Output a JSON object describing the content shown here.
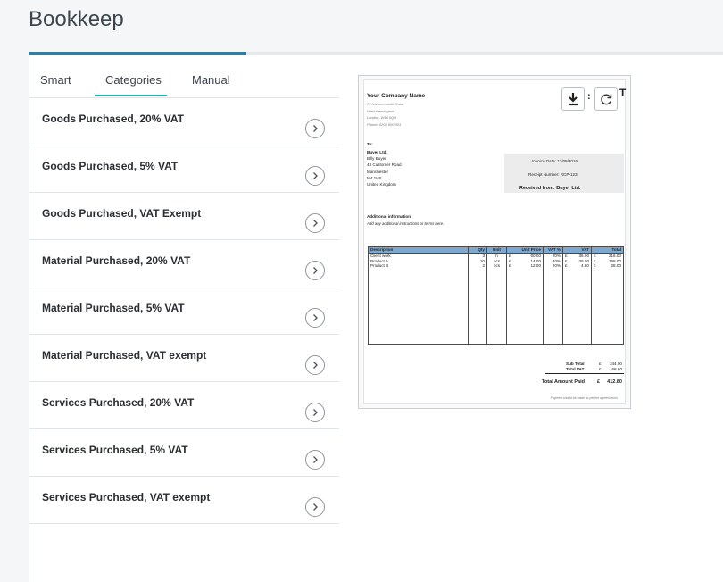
{
  "app": {
    "title": "Bookkeep"
  },
  "progress": {
    "percent": 31.4
  },
  "tabs": [
    {
      "label": "Smart",
      "active": false
    },
    {
      "label": "Categories",
      "active": true
    },
    {
      "label": "Manual",
      "active": false
    }
  ],
  "categories": [
    "Goods Purchased, 20% VAT",
    "Goods Purchased, 5% VAT",
    "Goods Purchased, VAT Exempt",
    "Material Purchased, 20% VAT",
    "Material Purchased, 5% VAT",
    "Material Purchased, VAT exempt",
    "Services Purchased, 20% VAT",
    "Services Purchased, 5% VAT",
    "Services Purchased, VAT exempt"
  ],
  "icons": {
    "item_action": "chevron-right-icon",
    "download": "download-icon",
    "rotate": "rotate-icon"
  },
  "colors": {
    "accent": "#1fb5b0",
    "progress": "#2f7da0",
    "table_header": "#7ea8cf"
  },
  "receipt": {
    "company": "Your Company Name",
    "company_address": [
      "77 Hammersmith Road",
      "West Kensington",
      "London, W14 0QH",
      "Phone: 0208 000 001"
    ],
    "title_partial": "T",
    "to_label": "To:",
    "buyer_lines": [
      "Buyer Ltd.",
      "Billy Buyer",
      "43 Customer Road",
      "Manchester",
      "M4 1HS",
      "United Kingdom"
    ],
    "invoice_date": "Invoice Date: 13/09/2016",
    "receipt_number": "Receipt Number: RCP-123",
    "received_from": "Received from: Buyer Ltd.",
    "additional_info_title": "Additional information",
    "additional_info_text": "Add any additional instructions or terms here.",
    "columns": [
      "Description",
      "Qty",
      "Unit",
      "Unit Price",
      "VAT %",
      "VAT",
      "Total"
    ],
    "rows": [
      {
        "description": "Client work",
        "qty": "3",
        "unit": "h",
        "cur1": "£",
        "unit_price": "60.00",
        "vat_pct": "20%",
        "cur2": "£",
        "vat": "36.00",
        "cur3": "£",
        "total": "216.00"
      },
      {
        "description": "Product A",
        "qty": "10",
        "unit": "pcs",
        "cur1": "£",
        "unit_price": "14.00",
        "vat_pct": "20%",
        "cur2": "£",
        "vat": "28.00",
        "cur3": "£",
        "total": "168.00"
      },
      {
        "description": "Product B",
        "qty": "2",
        "unit": "pcs",
        "cur1": "£",
        "unit_price": "12.00",
        "vat_pct": "20%",
        "cur2": "£",
        "vat": "4.80",
        "cur3": "£",
        "total": "28.00"
      }
    ],
    "subtotal_label": "Sub Total",
    "subtotal_currency": "£",
    "subtotal_value": "344.00",
    "total_vat_label": "Total VAT",
    "total_vat_currency": "£",
    "total_vat_value": "68.80",
    "total_paid_label": "Total Amount Paid",
    "total_paid_currency": "£",
    "total_paid_value": "412.80",
    "footer_note": "Payment should be made as per the agreed terms"
  }
}
